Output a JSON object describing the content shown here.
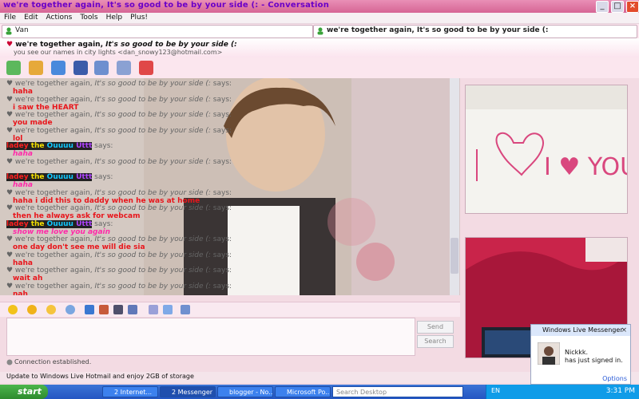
{
  "window": {
    "title": "we're together again,  It's so good to be by your side (: - Conversation"
  },
  "menu": [
    "File",
    "Edit",
    "Actions",
    "Tools",
    "Help",
    "Plus!"
  ],
  "contact_strip": {
    "left_contact": "Van",
    "right_contact": "we're together again,  It's so good to be by your side (:"
  },
  "header": {
    "name_plain": "we're together again,  ",
    "name_italic": "It's so good to be by your side (:",
    "subline": "you see our names in city lights <dan_snowy123@hotmail.com>"
  },
  "toolbar_icons": [
    "invite-icon",
    "send-files-icon",
    "video-call-icon",
    "call-icon",
    "share-folders-icon",
    "activities-icon",
    "block-icon"
  ],
  "chat": {
    "says_prefix": "we're together again,  ",
    "says_italic": "It's so good to be by your side (:",
    "says_suffix": " says:",
    "other_nick": "ladey the Ouuuu Uttt",
    "other_suffix": " says:",
    "messages": [
      {
        "sender": "self",
        "text": "haha"
      },
      {
        "sender": "self",
        "text": "i saw the HEART"
      },
      {
        "sender": "self",
        "text": "you made"
      },
      {
        "sender": "self",
        "text": "lol"
      },
      {
        "sender": "other",
        "text": "haha"
      },
      {
        "sender": "self",
        "text": ""
      },
      {
        "sender": "other",
        "text": "haha"
      },
      {
        "sender": "self",
        "text": "haha i did this to daddy when he was at home"
      },
      {
        "sender": "self",
        "text": "then he always ask for webcam"
      },
      {
        "sender": "other",
        "text": "show me love you again"
      },
      {
        "sender": "self",
        "text": "one day don't see me will die sia"
      },
      {
        "sender": "self",
        "text": "haha"
      },
      {
        "sender": "self",
        "text": "wait ah"
      },
      {
        "sender": "self",
        "text": "nah"
      }
    ]
  },
  "input": {
    "send_label": "Send",
    "search_label": "Search",
    "status": "Connection established."
  },
  "update_bar": "Update to Windows Live Hotmail and enjoy 2GB of storage",
  "toast": {
    "title": "Windows Live Messenger",
    "name": "Nickkk.",
    "status": "has just signed in.",
    "options": "Options"
  },
  "taskbar": {
    "start": "start",
    "tasks": [
      "2 Internet...",
      "2 Messenger",
      "blogger - No...",
      "Microsoft Po..."
    ],
    "search_placeholder": "Search Desktop",
    "lang": "EN",
    "clock": "3:31 PM"
  },
  "webcam": {
    "sign_text": "I ♥ YOU!"
  },
  "colors": {
    "message_red": "#e8151b",
    "nick_pink": "#ff2aa9",
    "title_purple": "#6a00c8"
  }
}
